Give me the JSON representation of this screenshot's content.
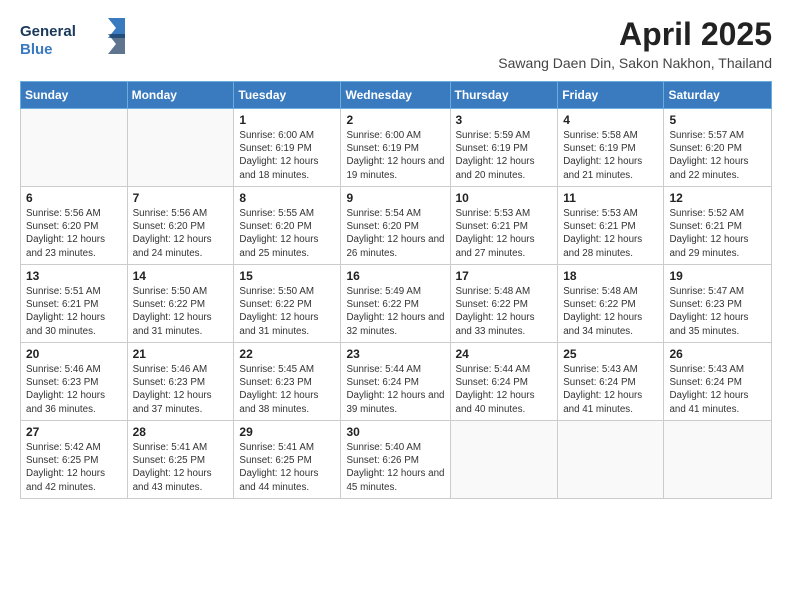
{
  "header": {
    "logo_line1": "General",
    "logo_line2": "Blue",
    "title": "April 2025",
    "subtitle": "Sawang Daen Din, Sakon Nakhon, Thailand"
  },
  "days_of_week": [
    "Sunday",
    "Monday",
    "Tuesday",
    "Wednesday",
    "Thursday",
    "Friday",
    "Saturday"
  ],
  "weeks": [
    [
      {
        "day": "",
        "info": ""
      },
      {
        "day": "",
        "info": ""
      },
      {
        "day": "1",
        "info": "Sunrise: 6:00 AM\nSunset: 6:19 PM\nDaylight: 12 hours and 18 minutes."
      },
      {
        "day": "2",
        "info": "Sunrise: 6:00 AM\nSunset: 6:19 PM\nDaylight: 12 hours and 19 minutes."
      },
      {
        "day": "3",
        "info": "Sunrise: 5:59 AM\nSunset: 6:19 PM\nDaylight: 12 hours and 20 minutes."
      },
      {
        "day": "4",
        "info": "Sunrise: 5:58 AM\nSunset: 6:19 PM\nDaylight: 12 hours and 21 minutes."
      },
      {
        "day": "5",
        "info": "Sunrise: 5:57 AM\nSunset: 6:20 PM\nDaylight: 12 hours and 22 minutes."
      }
    ],
    [
      {
        "day": "6",
        "info": "Sunrise: 5:56 AM\nSunset: 6:20 PM\nDaylight: 12 hours and 23 minutes."
      },
      {
        "day": "7",
        "info": "Sunrise: 5:56 AM\nSunset: 6:20 PM\nDaylight: 12 hours and 24 minutes."
      },
      {
        "day": "8",
        "info": "Sunrise: 5:55 AM\nSunset: 6:20 PM\nDaylight: 12 hours and 25 minutes."
      },
      {
        "day": "9",
        "info": "Sunrise: 5:54 AM\nSunset: 6:20 PM\nDaylight: 12 hours and 26 minutes."
      },
      {
        "day": "10",
        "info": "Sunrise: 5:53 AM\nSunset: 6:21 PM\nDaylight: 12 hours and 27 minutes."
      },
      {
        "day": "11",
        "info": "Sunrise: 5:53 AM\nSunset: 6:21 PM\nDaylight: 12 hours and 28 minutes."
      },
      {
        "day": "12",
        "info": "Sunrise: 5:52 AM\nSunset: 6:21 PM\nDaylight: 12 hours and 29 minutes."
      }
    ],
    [
      {
        "day": "13",
        "info": "Sunrise: 5:51 AM\nSunset: 6:21 PM\nDaylight: 12 hours and 30 minutes."
      },
      {
        "day": "14",
        "info": "Sunrise: 5:50 AM\nSunset: 6:22 PM\nDaylight: 12 hours and 31 minutes."
      },
      {
        "day": "15",
        "info": "Sunrise: 5:50 AM\nSunset: 6:22 PM\nDaylight: 12 hours and 31 minutes."
      },
      {
        "day": "16",
        "info": "Sunrise: 5:49 AM\nSunset: 6:22 PM\nDaylight: 12 hours and 32 minutes."
      },
      {
        "day": "17",
        "info": "Sunrise: 5:48 AM\nSunset: 6:22 PM\nDaylight: 12 hours and 33 minutes."
      },
      {
        "day": "18",
        "info": "Sunrise: 5:48 AM\nSunset: 6:22 PM\nDaylight: 12 hours and 34 minutes."
      },
      {
        "day": "19",
        "info": "Sunrise: 5:47 AM\nSunset: 6:23 PM\nDaylight: 12 hours and 35 minutes."
      }
    ],
    [
      {
        "day": "20",
        "info": "Sunrise: 5:46 AM\nSunset: 6:23 PM\nDaylight: 12 hours and 36 minutes."
      },
      {
        "day": "21",
        "info": "Sunrise: 5:46 AM\nSunset: 6:23 PM\nDaylight: 12 hours and 37 minutes."
      },
      {
        "day": "22",
        "info": "Sunrise: 5:45 AM\nSunset: 6:23 PM\nDaylight: 12 hours and 38 minutes."
      },
      {
        "day": "23",
        "info": "Sunrise: 5:44 AM\nSunset: 6:24 PM\nDaylight: 12 hours and 39 minutes."
      },
      {
        "day": "24",
        "info": "Sunrise: 5:44 AM\nSunset: 6:24 PM\nDaylight: 12 hours and 40 minutes."
      },
      {
        "day": "25",
        "info": "Sunrise: 5:43 AM\nSunset: 6:24 PM\nDaylight: 12 hours and 41 minutes."
      },
      {
        "day": "26",
        "info": "Sunrise: 5:43 AM\nSunset: 6:24 PM\nDaylight: 12 hours and 41 minutes."
      }
    ],
    [
      {
        "day": "27",
        "info": "Sunrise: 5:42 AM\nSunset: 6:25 PM\nDaylight: 12 hours and 42 minutes."
      },
      {
        "day": "28",
        "info": "Sunrise: 5:41 AM\nSunset: 6:25 PM\nDaylight: 12 hours and 43 minutes."
      },
      {
        "day": "29",
        "info": "Sunrise: 5:41 AM\nSunset: 6:25 PM\nDaylight: 12 hours and 44 minutes."
      },
      {
        "day": "30",
        "info": "Sunrise: 5:40 AM\nSunset: 6:26 PM\nDaylight: 12 hours and 45 minutes."
      },
      {
        "day": "",
        "info": ""
      },
      {
        "day": "",
        "info": ""
      },
      {
        "day": "",
        "info": ""
      }
    ]
  ]
}
